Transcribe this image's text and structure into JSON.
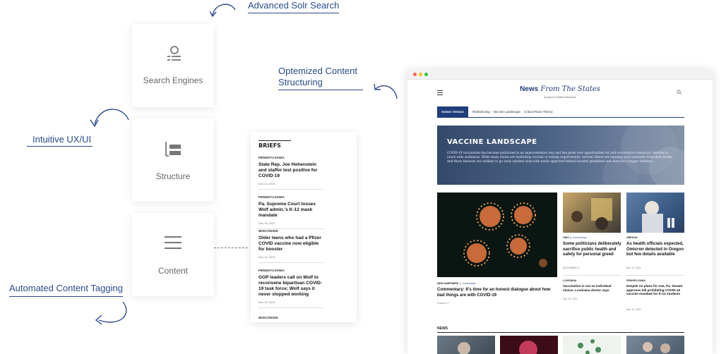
{
  "callouts": {
    "advanced_solr": "Advanced Solr Search",
    "optimized_content": "Optemized Content\nStructuring",
    "intuitive_ux": "Intuitive UX/UI",
    "automated_tagging": "Automated Content Tagging"
  },
  "cards": [
    {
      "label": "Search Engines",
      "icon": "search-list-icon"
    },
    {
      "label": "Structure",
      "icon": "structure-icon"
    },
    {
      "label": "Content",
      "icon": "menu-lines-icon"
    }
  ],
  "briefs": {
    "title": "BRIEFS",
    "items": [
      {
        "state": "PENNSYLVANIA",
        "headline": "State Rep. Joe Hohenstein and staffer test positive for COVID-19",
        "date": "Dec 13, 2021"
      },
      {
        "state": "PENNSYLVANIA",
        "headline": "Pa. Supreme Court tosses Wolf admin.'s K-12 mask mandate",
        "date": "Dec 10, 2021"
      },
      {
        "state": "WISCONSIN",
        "headline": "Older teens who had a Pfizer COVID vaccine now eligible for booster",
        "date": "Dec 10, 2021"
      },
      {
        "state": "PENNSYLVANIA",
        "headline": "GOP leaders call on Wolf to reconvene bipartisan COVID-19 task force; Wolf says it never stopped working",
        "date": "Dec 10, 2021"
      },
      {
        "state": "WISCONSIN",
        "headline": "",
        "date": ""
      }
    ]
  },
  "site": {
    "title_bold": "News",
    "title_italic": "From The States",
    "subtitle": "A project of States Newsroom",
    "rising_label": "RISING TRENDS",
    "trends": [
      "Redistricting",
      "Vaccine Landscape",
      "Critical Race Theory"
    ],
    "hero_title": "VACCINE LANDSCAPE",
    "hero_desc": "COVID-19 vaccination has become politicized in an unprecedented way and has given new opportunities for anti-vaccination conspiracy theories to reach wide audiences. While many states are instituting vaccine or testing requirements, several others are banning such mandates from their books. And those tensions are unlikely to go away anytime soon with newly approved federal booster guidelines and shots for younger children.",
    "main_story": {
      "state": "NEW HAMPSHIRE",
      "tag": "Commentary",
      "headline": "Commentary: It's time for an honest dialogue about how bad things are with COVID-19",
      "date": "3 hours 17"
    },
    "mid_story": {
      "state": "OHIO",
      "tag": "Commentary",
      "headline": "Some politicians deliberately sacrifice public health and safety for personal greed",
      "date": "DECEMBER 17"
    },
    "mid_story2": {
      "state": "LOUISIANA",
      "headline": "Vaccination is not an individual choice, Louisiana doctor says",
      "date": "Dec 13, 2021"
    },
    "right_story": {
      "state": "OREGON",
      "headline": "As health officials expected, Omicron detected in Oregon but few details available",
      "date": "Dec 13, 2021"
    },
    "right_story2": {
      "state": "PENNSYLVANIA",
      "headline": "Despite no plans for one, Pa. Senate approves bill prohibiting COVID-19 vaccine mandate for K-12 students",
      "date": "Dec 13, 2021"
    },
    "news_label": "NEWS"
  },
  "colors": {
    "accent": "#2b4a8a",
    "brand": "#1e3d7b"
  }
}
